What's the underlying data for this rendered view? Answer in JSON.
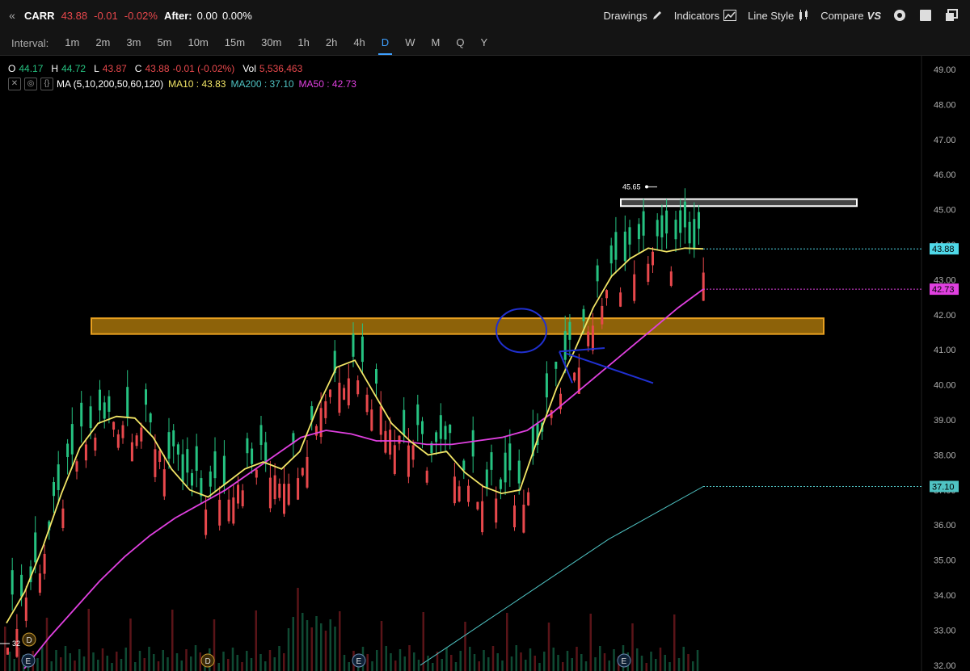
{
  "header": {
    "symbol": "CARR",
    "last": "43.88",
    "change": "-0.01",
    "change_pct": "-0.02%",
    "after_label": "After:",
    "after_value": "0.00",
    "after_pct": "0.00%",
    "drawings_label": "Drawings",
    "indicators_label": "Indicators",
    "linestyle_label": "Line Style",
    "compare_label": "Compare",
    "compare_badge": "VS"
  },
  "interval_bar": {
    "label": "Interval:",
    "items": [
      "1m",
      "2m",
      "3m",
      "5m",
      "10m",
      "15m",
      "30m",
      "1h",
      "2h",
      "4h",
      "D",
      "W",
      "M",
      "Q",
      "Y"
    ],
    "active": "D"
  },
  "ohlc": {
    "o_label": "O",
    "o": "44.17",
    "h_label": "H",
    "h": "44.72",
    "l_label": "L",
    "l": "43.87",
    "c_label": "C",
    "c": "43.88",
    "chg": "-0.01 (-0.02%)",
    "vol_label": "Vol",
    "vol": "5,536,463"
  },
  "ma_legend": {
    "name": "MA (5,10,200,50,60,120)",
    "ma10": "MA10 : 43.83",
    "ma200": "MA200 : 37.10",
    "ma50": "MA50 : 42.73"
  },
  "colors": {
    "up": "#26c281",
    "down": "#e8484c",
    "ma10": "#f2e566",
    "ma50": "#e040e0",
    "ma200": "#4fc3c3",
    "zone": "#a6730a",
    "annotation": "#2030d0"
  },
  "chart_data": {
    "type": "candlestick",
    "y_axis": {
      "min": 32,
      "max": 49,
      "ticks": [
        "49.00",
        "48.00",
        "47.00",
        "46.00",
        "45.00",
        "44.00",
        "43.00",
        "42.00",
        "41.00",
        "40.00",
        "39.00",
        "38.00",
        "37.00",
        "36.00",
        "35.00",
        "34.00",
        "33.00",
        "32.00"
      ]
    },
    "price_tags": [
      {
        "label": "43.88",
        "value": 43.88,
        "color": "#4fd8e8"
      },
      {
        "label": "42.73",
        "value": 42.73,
        "color": "#e040e0"
      },
      {
        "label": "37.10",
        "value": 37.1,
        "color": "#4fc3c3"
      }
    ],
    "high_marker": {
      "label": "45.65",
      "value": 45.65
    },
    "earnings_markers": [
      "D",
      "E",
      "D",
      "E",
      "E"
    ],
    "left_marker": "32",
    "resistance_zone": {
      "low": 41.45,
      "high": 41.9
    },
    "top_box": {
      "low": 45.1,
      "high": 45.3
    },
    "ma10": [
      33.2,
      34.1,
      35.4,
      36.9,
      38.2,
      38.9,
      39.1,
      39.05,
      38.5,
      37.6,
      37.0,
      36.8,
      37.2,
      37.6,
      37.8,
      37.6,
      38.1,
      39.4,
      40.5,
      40.7,
      39.8,
      38.9,
      38.4,
      38.0,
      38.1,
      37.5,
      37.1,
      36.9,
      37.0,
      38.5,
      39.9,
      41.0,
      42.2,
      43.1,
      43.6,
      43.9,
      43.8,
      43.9,
      43.88
    ],
    "ma50": [
      31.9,
      32.8,
      33.6,
      34.4,
      35.1,
      35.7,
      36.2,
      36.6,
      37.0,
      37.5,
      38.0,
      38.5,
      38.7,
      38.6,
      38.4,
      38.4,
      38.3,
      38.3,
      38.4,
      38.5,
      38.7,
      39.2,
      39.8,
      40.4,
      41.0,
      41.6,
      42.2,
      42.73
    ],
    "ma200": [
      32.0,
      32.6,
      33.2,
      33.8,
      34.4,
      35.0,
      35.6,
      36.1,
      36.6,
      37.1
    ]
  }
}
